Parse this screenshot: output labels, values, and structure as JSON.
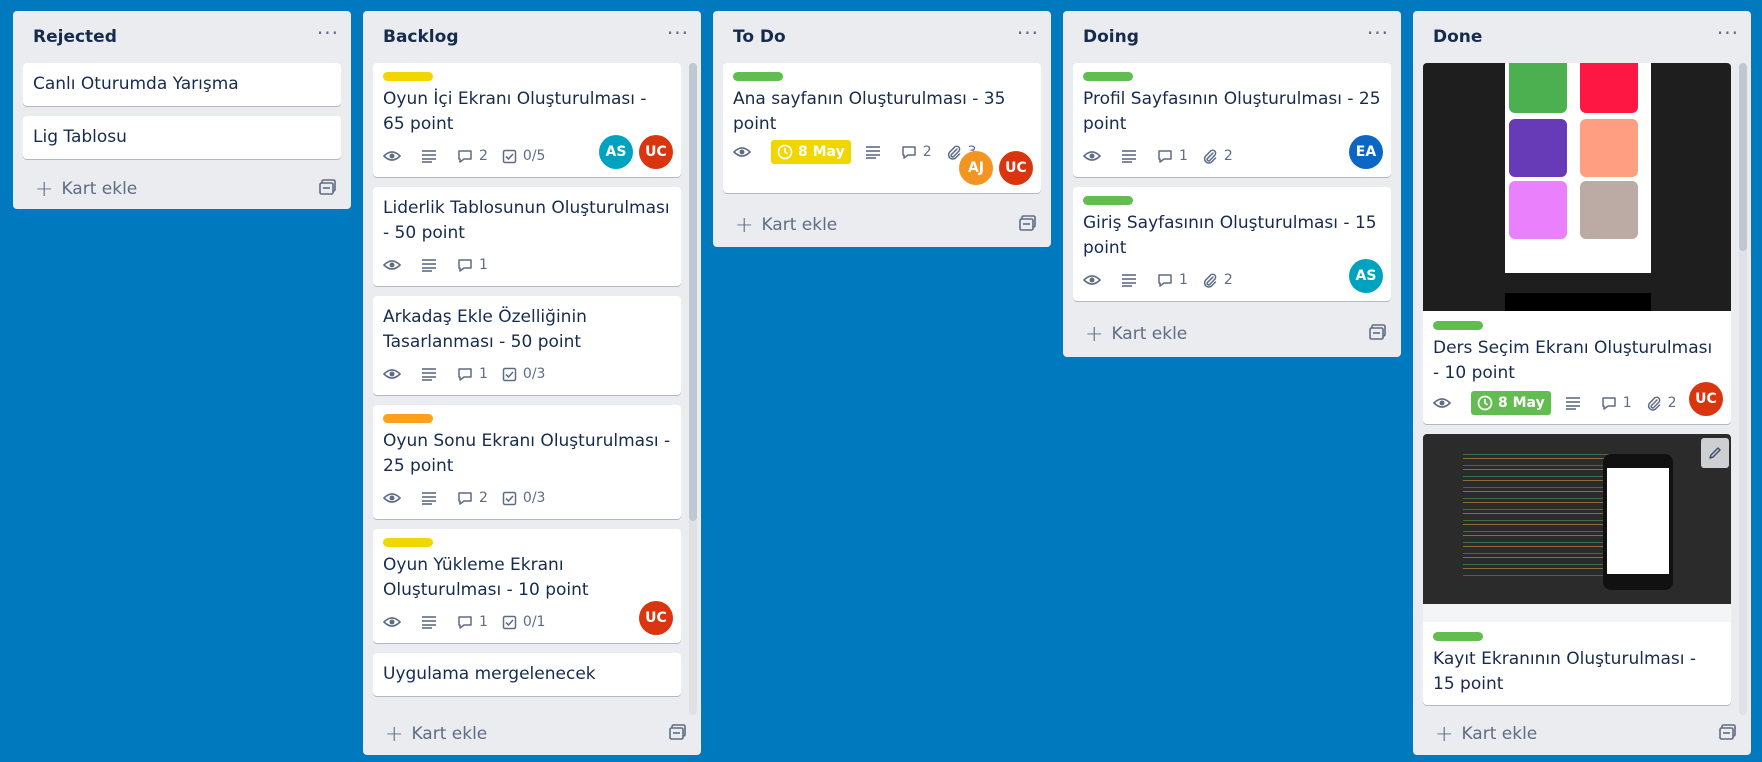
{
  "lists": [
    {
      "title": "Rejected",
      "add_label": "Kart ekle",
      "cards": [
        {
          "title": "Canlı Oturumda Yarışma"
        },
        {
          "title": "Lig Tablosu"
        }
      ]
    },
    {
      "title": "Backlog",
      "add_label": "Kart ekle",
      "cards": [
        {
          "label_color": "#f2d600",
          "title": "Oyun İçi Ekranı Oluşturulması - 65 point",
          "comments": "2",
          "checklist": "0/5",
          "members": [
            "AS",
            "UC"
          ]
        },
        {
          "title": "Liderlik Tablosunun Oluşturulması - 50 point",
          "comments": "1"
        },
        {
          "title": "Arkadaş Ekle Özelliğinin Tasarlanması - 50 point",
          "comments": "1",
          "checklist": "0/3"
        },
        {
          "label_color": "#ff9f1a",
          "title": "Oyun Sonu Ekranı Oluşturulması - 25 point",
          "comments": "2",
          "checklist": "0/3"
        },
        {
          "label_color": "#f2d600",
          "title": "Oyun Yükleme Ekranı Oluşturulması - 10 point",
          "comments": "1",
          "checklist": "0/1",
          "members": [
            "UC"
          ]
        },
        {
          "title": "Uygulama mergelenecek"
        }
      ]
    },
    {
      "title": "To Do",
      "add_label": "Kart ekle",
      "cards": [
        {
          "label_color": "#61bd4f",
          "title": "Ana sayfanın Oluşturulması - 35 point",
          "due": "8 May",
          "comments": "2",
          "attachments": "3",
          "members": [
            "AJ",
            "UC"
          ]
        }
      ]
    },
    {
      "title": "Doing",
      "add_label": "Kart ekle",
      "cards": [
        {
          "label_color": "#61bd4f",
          "title": "Profil Sayfasının Oluşturulması - 25 point",
          "comments": "1",
          "attachments": "2",
          "members": [
            "EA"
          ]
        },
        {
          "label_color": "#61bd4f",
          "title": "Giriş Sayfasının Oluşturulması - 15 point",
          "comments": "1",
          "attachments": "2",
          "members": [
            "AS"
          ]
        }
      ]
    },
    {
      "title": "Done",
      "add_label": "Kart ekle",
      "cards": [
        {
          "label_color": "#61bd4f",
          "title": "Ders Seçim Ekranı Oluşturulması - 10 point",
          "due": "8 May",
          "comments": "1",
          "attachments": "2",
          "members": [
            "UC"
          ]
        },
        {
          "label_color": "#61bd4f",
          "title": "Kayıt Ekranının Oluşturulması - 15 point"
        }
      ]
    }
  ],
  "avatar_colors": {
    "AS": "#00a3bf",
    "UC": "#d9360f",
    "AJ": "#f29522",
    "EA": "#0c66c4"
  },
  "colors": {
    "board_bg": "#0079bf",
    "list_bg": "#ebecf0",
    "due_yellow": "#f2d600",
    "due_green": "#61bd4f"
  }
}
